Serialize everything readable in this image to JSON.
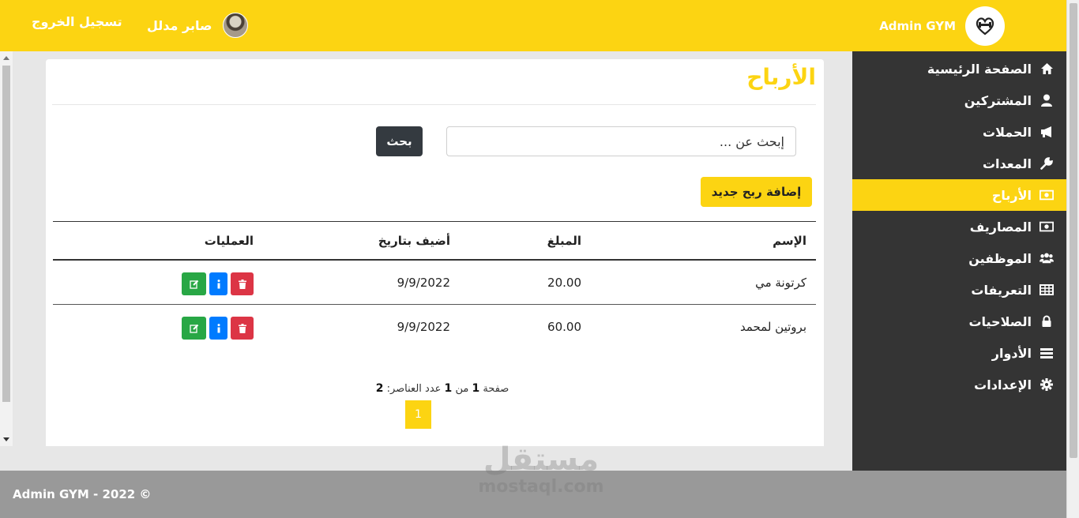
{
  "header": {
    "brand_name": "Admin GYM",
    "user_name": "صابر مدلل",
    "logout_label": "تسجيل الخروج"
  },
  "sidebar": {
    "items": [
      {
        "label": "الصفحة الرئيسية",
        "icon": "home-icon"
      },
      {
        "label": "المشتركين",
        "icon": "user-icon"
      },
      {
        "label": "الحملات",
        "icon": "megaphone-icon"
      },
      {
        "label": "المعدات",
        "icon": "wrench-icon"
      },
      {
        "label": "الأرباح",
        "icon": "money-icon",
        "active": true
      },
      {
        "label": "المصاريف",
        "icon": "money-icon"
      },
      {
        "label": "الموظفين",
        "icon": "users-icon"
      },
      {
        "label": "التعريفات",
        "icon": "table-icon"
      },
      {
        "label": "الصلاحيات",
        "icon": "lock-icon"
      },
      {
        "label": "الأدوار",
        "icon": "list-icon"
      },
      {
        "label": "الإعدادات",
        "icon": "gear-icon"
      }
    ]
  },
  "main": {
    "title": "الأرباح",
    "search_placeholder": "إبحث عن ...",
    "search_label": "بحث",
    "add_label": "إضافة ربح جديد",
    "columns": [
      "الإسم",
      "المبلغ",
      "أضيف بتاريخ",
      "العمليات"
    ],
    "rows": [
      {
        "name": "كرتونة مي",
        "amount": "20.00",
        "date": "9/9/2022"
      },
      {
        "name": "بروتين لمحمد",
        "amount": "60.00",
        "date": "9/9/2022"
      }
    ]
  },
  "pagination": {
    "page_word": "صفحة",
    "current": "1",
    "of_word": "من",
    "total_pages": "1",
    "count_label": "عدد العناصر:",
    "count": "2",
    "page_button": "1"
  },
  "footer": {
    "text": "Admin GYM - 2022 ©"
  },
  "watermark": {
    "arabic": "مستقل",
    "latin": "mostaql.com"
  },
  "colors": {
    "accent": "#fcd412",
    "sidebar": "#343434",
    "footer": "#999999",
    "edit": "#28a745",
    "info": "#007bff",
    "delete": "#dc3545"
  }
}
